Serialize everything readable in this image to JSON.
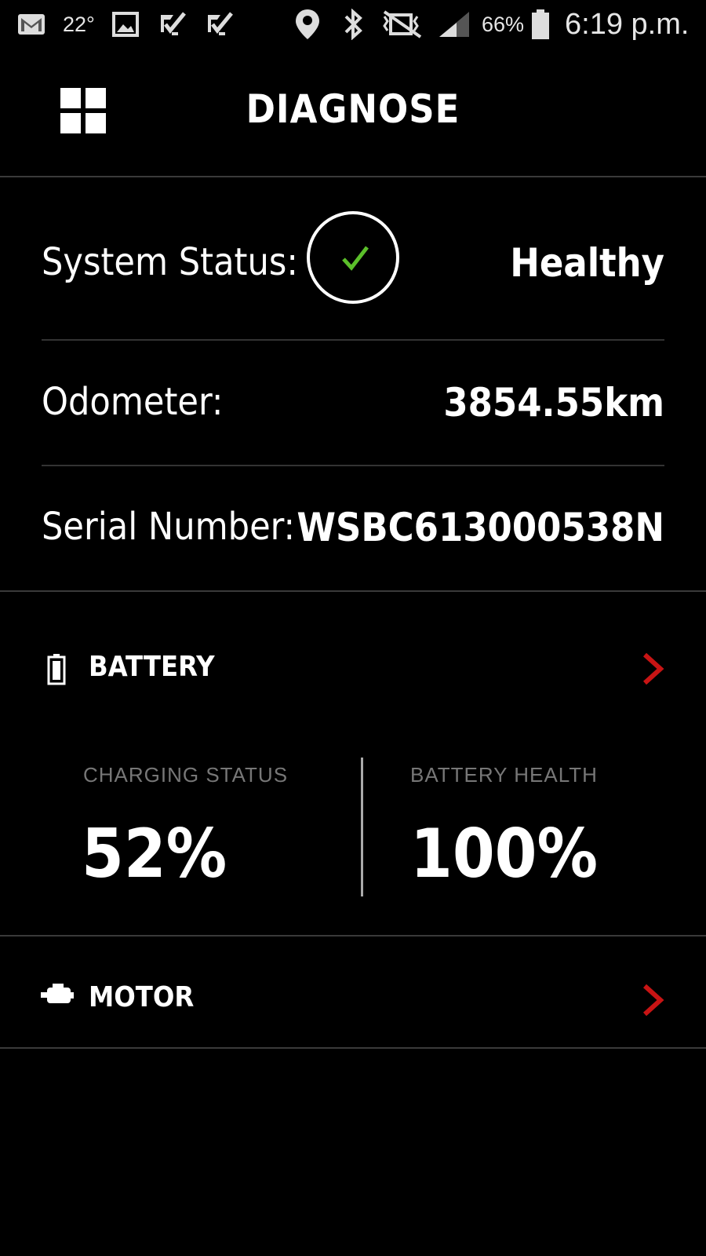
{
  "status_bar": {
    "temperature": "22°",
    "battery_percent": "66%",
    "time": "6:19 p.m.",
    "icons": [
      "gmail-icon",
      "gallery-icon",
      "task-check-icon",
      "task-check-icon",
      "location-pin-icon",
      "bluetooth-icon",
      "vibrate-icon",
      "signal-icon",
      "battery-icon"
    ]
  },
  "header": {
    "title": "DIAGNOSE",
    "menu_icon": "grid-menu-icon"
  },
  "overview": {
    "system_status_label": "System Status:",
    "system_status_value": "Healthy",
    "odometer_label": "Odometer:",
    "odometer_value": "3854.55km",
    "serial_label": "Serial Number:",
    "serial_value": "WSBC613000538N"
  },
  "battery": {
    "title": "BATTERY",
    "charging_label": "CHARGING STATUS",
    "charging_value": "52%",
    "health_label": "BATTERY HEALTH",
    "health_value": "100%"
  },
  "motor": {
    "title": "MOTOR"
  },
  "colors": {
    "accent": "#c81414",
    "check": "#5bbf2a",
    "background": "#000000"
  }
}
